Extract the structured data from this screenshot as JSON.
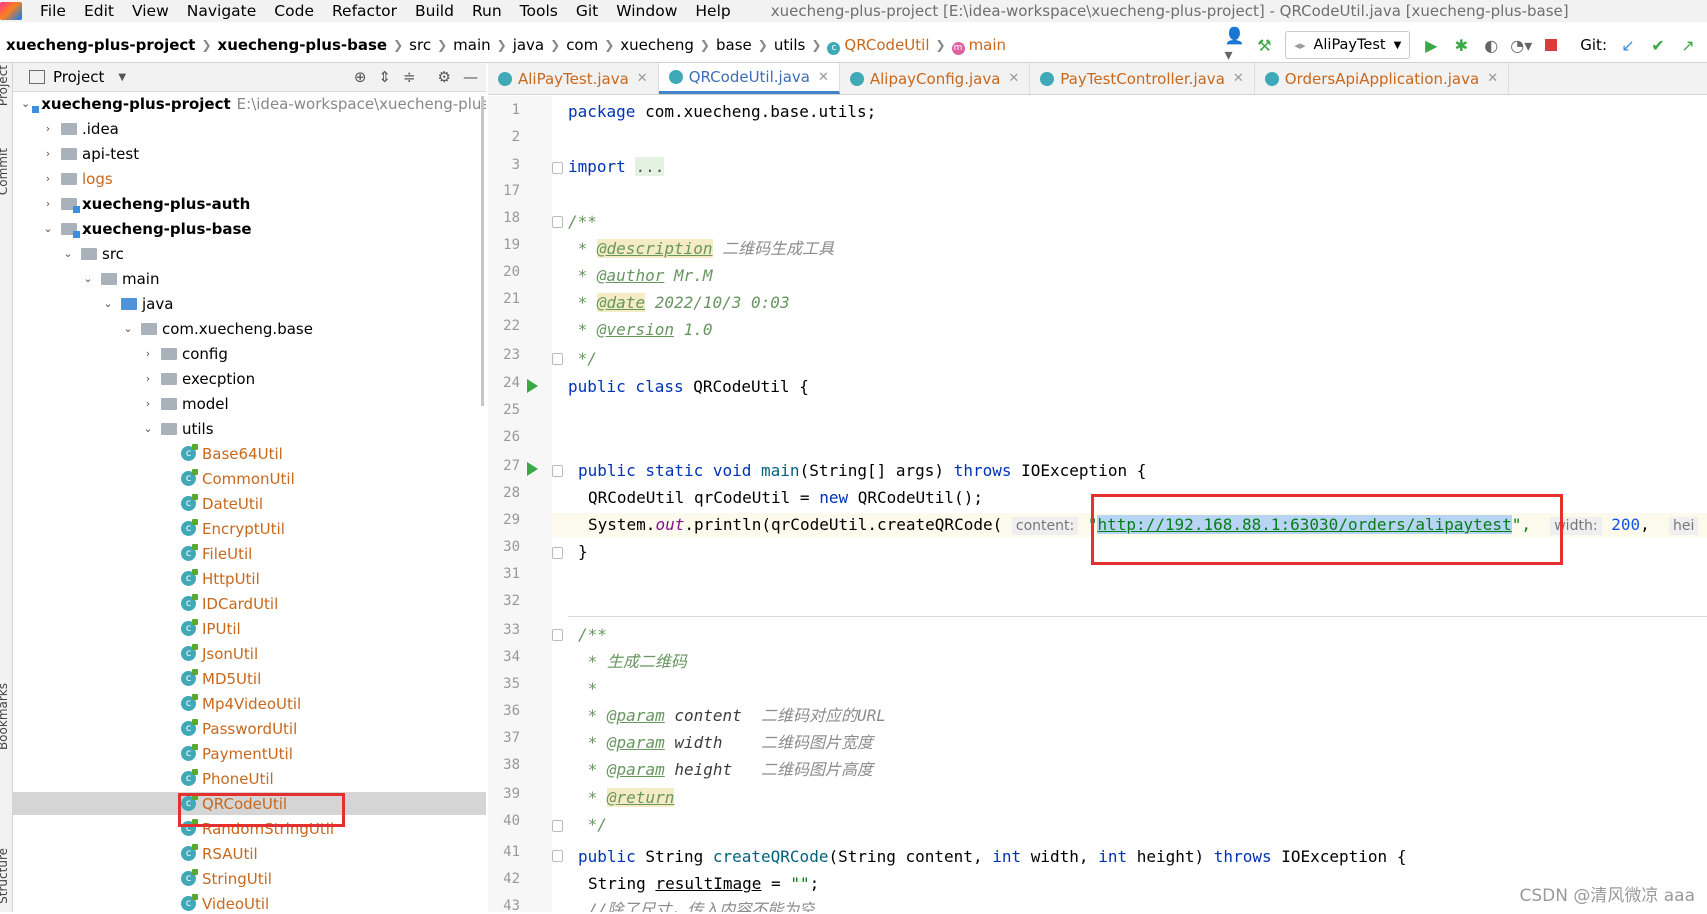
{
  "menubar": {
    "items": [
      "File",
      "Edit",
      "View",
      "Navigate",
      "Code",
      "Refactor",
      "Build",
      "Run",
      "Tools",
      "Git",
      "Window",
      "Help"
    ],
    "window_title": "xuecheng-plus-project [E:\\idea-workspace\\xuecheng-plus-project] - QRCodeUtil.java [xuecheng-plus-base]"
  },
  "breadcrumb": [
    "xuecheng-plus-project",
    "xuecheng-plus-base",
    "src",
    "main",
    "java",
    "com",
    "xuecheng",
    "base",
    "utils",
    "QRCodeUtil",
    "main"
  ],
  "toolbar": {
    "run_config": "AliPayTest",
    "git_label": "Git:"
  },
  "project_panel": {
    "title": "Project",
    "root_name": "xuecheng-plus-project",
    "root_path": "E:\\idea-workspace\\xuecheng-plus-pl",
    "tree": [
      {
        "label": ".idea",
        "type": "folder",
        "depth": 1,
        "arrow": "right"
      },
      {
        "label": "api-test",
        "type": "folder",
        "depth": 1,
        "arrow": "right"
      },
      {
        "label": "logs",
        "type": "folder",
        "depth": 1,
        "arrow": "right",
        "style": "orange"
      },
      {
        "label": "xuecheng-plus-auth",
        "type": "module",
        "depth": 1,
        "arrow": "right",
        "bold": true
      },
      {
        "label": "xuecheng-plus-base",
        "type": "module",
        "depth": 1,
        "arrow": "down",
        "bold": true
      },
      {
        "label": "src",
        "type": "folder",
        "depth": 2,
        "arrow": "down"
      },
      {
        "label": "main",
        "type": "folder",
        "depth": 3,
        "arrow": "down"
      },
      {
        "label": "java",
        "type": "folder",
        "depth": 4,
        "arrow": "down",
        "blue": true
      },
      {
        "label": "com.xuecheng.base",
        "type": "package",
        "depth": 5,
        "arrow": "down"
      },
      {
        "label": "config",
        "type": "package",
        "depth": 6,
        "arrow": "right"
      },
      {
        "label": "execption",
        "type": "package",
        "depth": 6,
        "arrow": "right"
      },
      {
        "label": "model",
        "type": "package",
        "depth": 6,
        "arrow": "right"
      },
      {
        "label": "utils",
        "type": "package",
        "depth": 6,
        "arrow": "down"
      },
      {
        "label": "Base64Util",
        "type": "class",
        "depth": 7
      },
      {
        "label": "CommonUtil",
        "type": "class",
        "depth": 7
      },
      {
        "label": "DateUtil",
        "type": "class",
        "depth": 7
      },
      {
        "label": "EncryptUtil",
        "type": "class",
        "depth": 7
      },
      {
        "label": "FileUtil",
        "type": "class",
        "depth": 7
      },
      {
        "label": "HttpUtil",
        "type": "class",
        "depth": 7
      },
      {
        "label": "IDCardUtil",
        "type": "class",
        "depth": 7
      },
      {
        "label": "IPUtil",
        "type": "class",
        "depth": 7
      },
      {
        "label": "JsonUtil",
        "type": "class",
        "depth": 7
      },
      {
        "label": "MD5Util",
        "type": "class",
        "depth": 7
      },
      {
        "label": "Mp4VideoUtil",
        "type": "class",
        "depth": 7
      },
      {
        "label": "PasswordUtil",
        "type": "class",
        "depth": 7
      },
      {
        "label": "PaymentUtil",
        "type": "class",
        "depth": 7
      },
      {
        "label": "PhoneUtil",
        "type": "class",
        "depth": 7
      },
      {
        "label": "QRCodeUtil",
        "type": "class",
        "depth": 7,
        "selected": true
      },
      {
        "label": "RandomStringUtil",
        "type": "class",
        "depth": 7
      },
      {
        "label": "RSAUtil",
        "type": "class",
        "depth": 7
      },
      {
        "label": "StringUtil",
        "type": "class",
        "depth": 7
      },
      {
        "label": "VideoUtil",
        "type": "class",
        "depth": 7
      }
    ]
  },
  "tool_strip": {
    "project": "Project",
    "commit": "Commit",
    "bookmarks": "Bookmarks",
    "structure": "Structure"
  },
  "tabs": [
    {
      "label": "AliPayTest.java",
      "orange": true
    },
    {
      "label": "QRCodeUtil.java",
      "active": true
    },
    {
      "label": "AlipayConfig.java",
      "orange": true
    },
    {
      "label": "PayTestController.java",
      "orange": true
    },
    {
      "label": "OrdersApiApplication.java",
      "orange": true
    }
  ],
  "editor": {
    "line_numbers": [
      "1",
      "2",
      "3",
      "17",
      "18",
      "19",
      "20",
      "21",
      "22",
      "23",
      "24",
      "25",
      "26",
      "27",
      "28",
      "29",
      "30",
      "31",
      "32",
      "33",
      "34",
      "35",
      "36",
      "37",
      "38",
      "39",
      "40",
      "41",
      "42",
      "43"
    ],
    "code": {
      "package_kw": "package",
      "package_name": " com.xuecheng.base.utils;",
      "import_kw": "import",
      "import_fold": "...",
      "jd_open": "/**",
      "jd_star": " * ",
      "jd_close": " */",
      "tag_description": "@description",
      "text_description": " 二维码生成工具",
      "tag_author": "@author",
      "text_author": " Mr.M",
      "tag_date": "@date",
      "text_date": " 2022/10/3 0:03",
      "tag_version": "@version",
      "text_version": " 1.0",
      "kw_public_class": "public class",
      "class_decl": " QRCodeUtil {",
      "main_kw": "public static void",
      "main_name": "main",
      "main_params": "(String[] args) ",
      "throws_kw": "throws",
      "ioexc_brace": " IOException {",
      "l28_a": "QRCodeUtil qrCodeUtil = ",
      "new_kw": "new",
      "l28_b": " QRCodeUtil();",
      "l29_a": "System.",
      "out_field": "out",
      "l29_b": ".println(qrCodeUtil.createQRCode(",
      "hint_content": "content:",
      "quote": "\"",
      "url": "http://192.168.88.1:63030/orders/alipaytest",
      "quote_comma": "\",",
      "hint_width": "width:",
      "num_200": "200",
      "comma": ",",
      "hint_height": "hei",
      "close_brace": "}",
      "cm_gen": "生成二维码",
      "tag_param": "@param",
      "p_content": " content",
      "cm_content": "  二维码对应的URL",
      "p_width": " width",
      "cm_width": "    二维码图片宽度",
      "p_height": " height",
      "cm_height": "   二维码图片高度",
      "tag_return": "@return",
      "kw_public": "public",
      "string_type": " String ",
      "create_name": "createQRCode",
      "create_params_a": "(String content, ",
      "int_kw": "int",
      "create_params_b": " width, ",
      "create_params_c": " height) ",
      "l42_a": "String ",
      "l42_var": "resultImage",
      "l42_b": " = ",
      "l42_str": "\"\"",
      "l42_c": ";",
      "l43": "//除了尺寸，传入内容不能为空"
    }
  },
  "watermark": "CSDN @清风微凉 aaa"
}
